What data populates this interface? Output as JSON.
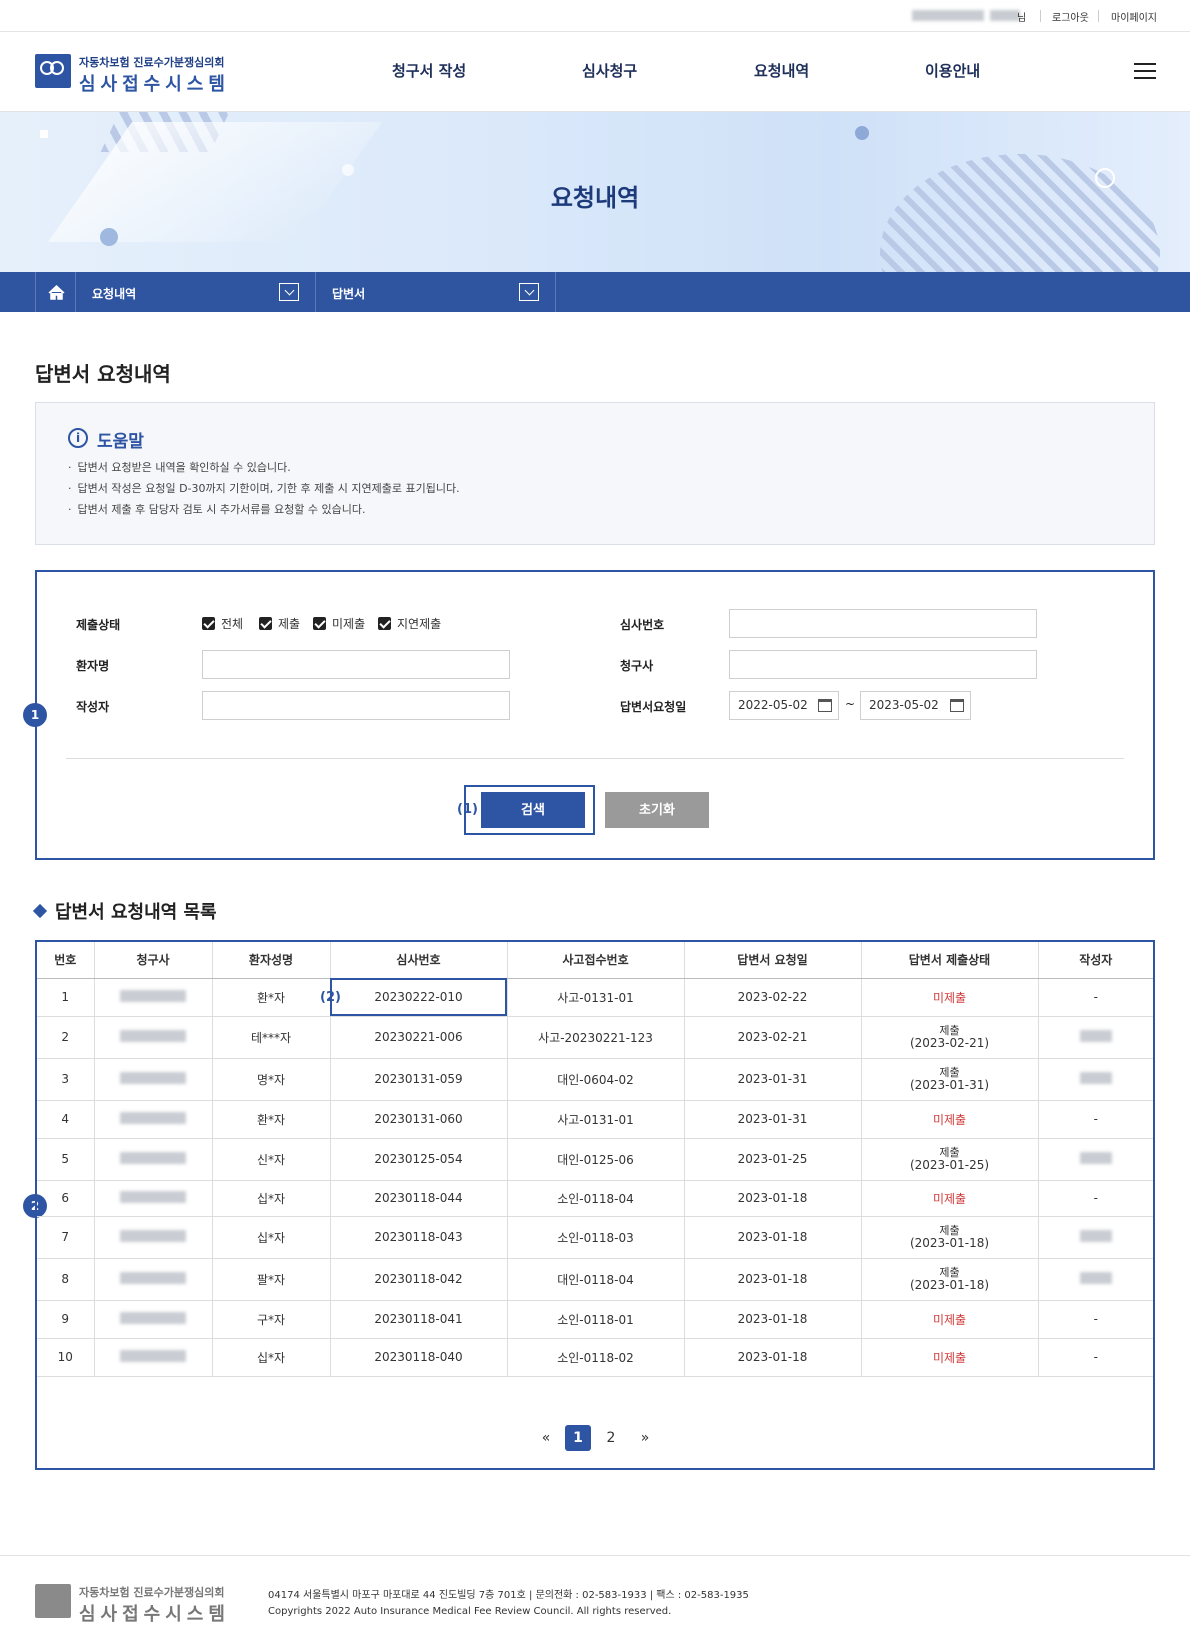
{
  "util": {
    "suffix": "님",
    "logout": "로그아웃",
    "mypage": "마이페이지"
  },
  "header": {
    "logo_sub": "자동차보험 진료수가분쟁심의회",
    "logo_main": "심사접수시스템",
    "nav": [
      "청구서 작성",
      "심사청구",
      "요청내역",
      "이용안내"
    ]
  },
  "banner": {
    "title": "요청내역"
  },
  "breadcrumb": {
    "level1": "요청내역",
    "level2": "답변서"
  },
  "page_title": "답변서 요청내역",
  "help": {
    "title": "도움말",
    "items": [
      "답변서 요청받은 내역을 확인하실 수 있습니다.",
      "답변서 작성은 요청일 D-30까지 기한이며, 기한 후 제출 시 지연제출로 표기됩니다.",
      "답변서 제출 후 담당자 검토 시 추가서류를 요청할 수 있습니다."
    ]
  },
  "search": {
    "status_label": "제출상태",
    "status_options": [
      "전체",
      "제출",
      "미제출",
      "지연제출"
    ],
    "review_no_label": "심사번호",
    "patient_label": "환자명",
    "claimant_label": "청구사",
    "writer_label": "작성자",
    "request_date_label": "답변서요청일",
    "date_from": "2022-05-02",
    "date_to": "2023-05-02",
    "tilde": "~",
    "search_button": "검색",
    "reset_button": "초기화"
  },
  "markers": {
    "m1": "1",
    "m2": "2",
    "a1": "(1)",
    "a2": "(2)"
  },
  "list": {
    "title": "답변서 요청내역 목록",
    "columns": [
      "번호",
      "청구사",
      "환자성명",
      "심사번호",
      "사고접수번호",
      "답변서 요청일",
      "답변서 제출상태",
      "작성자"
    ],
    "rows": [
      {
        "no": "1",
        "patient": "환*자",
        "review_no": "20230222-010",
        "accident_no": "사고-0131-01",
        "request_date": "2023-02-22",
        "status": "미제출",
        "status_date": "",
        "writer": "-"
      },
      {
        "no": "2",
        "patient": "테***자",
        "review_no": "20230221-006",
        "accident_no": "사고-20230221-123",
        "request_date": "2023-02-21",
        "status": "제출",
        "status_date": "(2023-02-21)",
        "writer": ""
      },
      {
        "no": "3",
        "patient": "명*자",
        "review_no": "20230131-059",
        "accident_no": "대인-0604-02",
        "request_date": "2023-01-31",
        "status": "제출",
        "status_date": "(2023-01-31)",
        "writer": ""
      },
      {
        "no": "4",
        "patient": "환*자",
        "review_no": "20230131-060",
        "accident_no": "사고-0131-01",
        "request_date": "2023-01-31",
        "status": "미제출",
        "status_date": "",
        "writer": "-"
      },
      {
        "no": "5",
        "patient": "신*자",
        "review_no": "20230125-054",
        "accident_no": "대인-0125-06",
        "request_date": "2023-01-25",
        "status": "제출",
        "status_date": "(2023-01-25)",
        "writer": ""
      },
      {
        "no": "6",
        "patient": "십*자",
        "review_no": "20230118-044",
        "accident_no": "소인-0118-04",
        "request_date": "2023-01-18",
        "status": "미제출",
        "status_date": "",
        "writer": "-"
      },
      {
        "no": "7",
        "patient": "십*자",
        "review_no": "20230118-043",
        "accident_no": "소인-0118-03",
        "request_date": "2023-01-18",
        "status": "제출",
        "status_date": "(2023-01-18)",
        "writer": ""
      },
      {
        "no": "8",
        "patient": "팔*자",
        "review_no": "20230118-042",
        "accident_no": "대인-0118-04",
        "request_date": "2023-01-18",
        "status": "제출",
        "status_date": "(2023-01-18)",
        "writer": ""
      },
      {
        "no": "9",
        "patient": "구*자",
        "review_no": "20230118-041",
        "accident_no": "소인-0118-01",
        "request_date": "2023-01-18",
        "status": "미제출",
        "status_date": "",
        "writer": "-"
      },
      {
        "no": "10",
        "patient": "십*자",
        "review_no": "20230118-040",
        "accident_no": "소인-0118-02",
        "request_date": "2023-01-18",
        "status": "미제출",
        "status_date": "",
        "writer": "-"
      }
    ]
  },
  "pagination": {
    "first": "«",
    "pages": [
      "1",
      "2"
    ],
    "last": "»",
    "current": "1"
  },
  "footer": {
    "logo_sub": "자동차보험 진료수가분쟁심의회",
    "logo_main": "심사접수시스템",
    "address": "04174 서울특별시 마포구 마포대로 44 진도빌딩 7층 701호  |  문의전화 : 02-583-1933  |  팩스 : 02-583-1935",
    "copyright": "Copyrights 2022 Auto Insurance Medical Fee Review Council. All rights reserved."
  },
  "colors": {
    "primary": "#2d55a3",
    "unsubmitted": "#d23a3a",
    "reset": "#9a9a9a"
  }
}
